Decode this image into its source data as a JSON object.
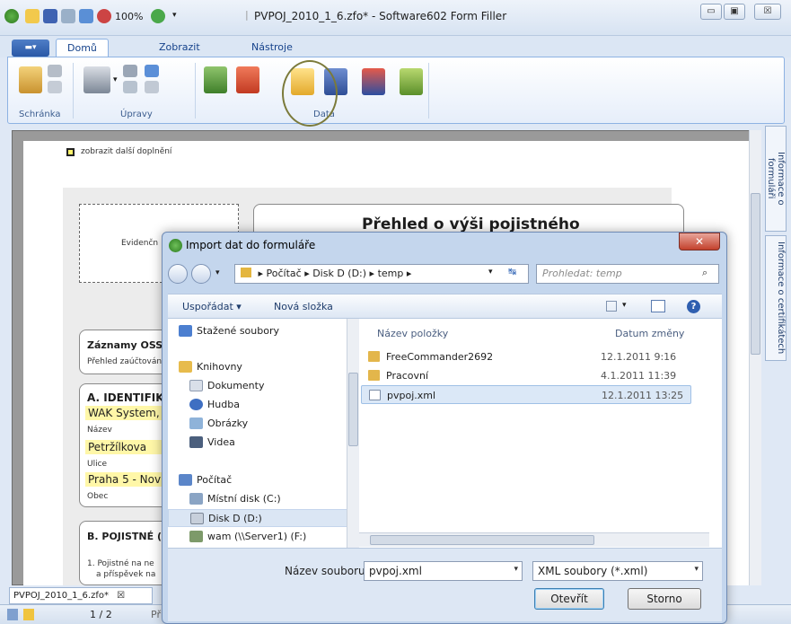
{
  "window": {
    "title": "PVPOJ_2010_1_6.zfo* - Software602 Form Filler",
    "zoom": "100%",
    "minimize": "▭",
    "maximize": "▣",
    "close": "☒"
  },
  "ribbon": {
    "file_tab": "▬▾",
    "tabs": [
      "Domů",
      "Zobrazit",
      "Nástroje"
    ],
    "groups": [
      "Schránka",
      "Úpravy",
      "Data"
    ]
  },
  "document": {
    "checkbox_label": "zobrazit další doplnění",
    "form_title": "Přehled o výši pojistného",
    "evidence_label": "Evidenčn",
    "section_records": "Záznamy OSSZ",
    "section_records_sub": "Přehled zaúčtován",
    "section_a": "A. IDENTIFIKA",
    "company": "WAK System,",
    "name_label": "Název",
    "street_value": "Petržílkova",
    "street_label": "Ulice",
    "city_value": "Praha 5 - Nov",
    "city_label": "Obec",
    "section_b": "B. POJISTNÉ (",
    "b_line1": "1. Pojistné na ne",
    "b_line2": "a příspěvek na",
    "tab_name": "PVPOJ_2010_1_6.zfo*",
    "tab_close": "☒"
  },
  "right_panel": {
    "tab1": "Informace o formuláři",
    "tab2": "Informace o certifikátech"
  },
  "status": {
    "page": "1 / 2",
    "pr": "Př"
  },
  "dialog": {
    "title": "Import dat do formuláře",
    "close": "✕",
    "breadcrumb": "▸ Počítač ▸ Disk D (D:) ▸ temp ▸",
    "search_placeholder": "Prohledat: temp",
    "organize": "Uspořádat ▾",
    "new_folder": "Nová složka",
    "nav_items": [
      "Stažené soubory",
      "Knihovny",
      "Dokumenty",
      "Hudba",
      "Obrázky",
      "Videa",
      "Počítač",
      "Místní disk (C:)",
      "Disk D (D:)",
      "wam (\\\\Server1) (F:)"
    ],
    "columns": {
      "name": "Název položky",
      "date": "Datum změny"
    },
    "files": [
      {
        "name": "FreeCommander2692",
        "date": "12.1.2011 9:16",
        "type": "folder"
      },
      {
        "name": "Pracovní",
        "date": "4.1.2011 11:39",
        "type": "folder"
      },
      {
        "name": "pvpoj.xml",
        "date": "12.1.2011 13:25",
        "type": "xml"
      }
    ],
    "filename_label": "Název souboru:",
    "filename_value": "pvpoj.xml",
    "filetype": "XML soubory (*.xml)",
    "open_button": "Otevřít",
    "cancel_button": "Storno"
  }
}
